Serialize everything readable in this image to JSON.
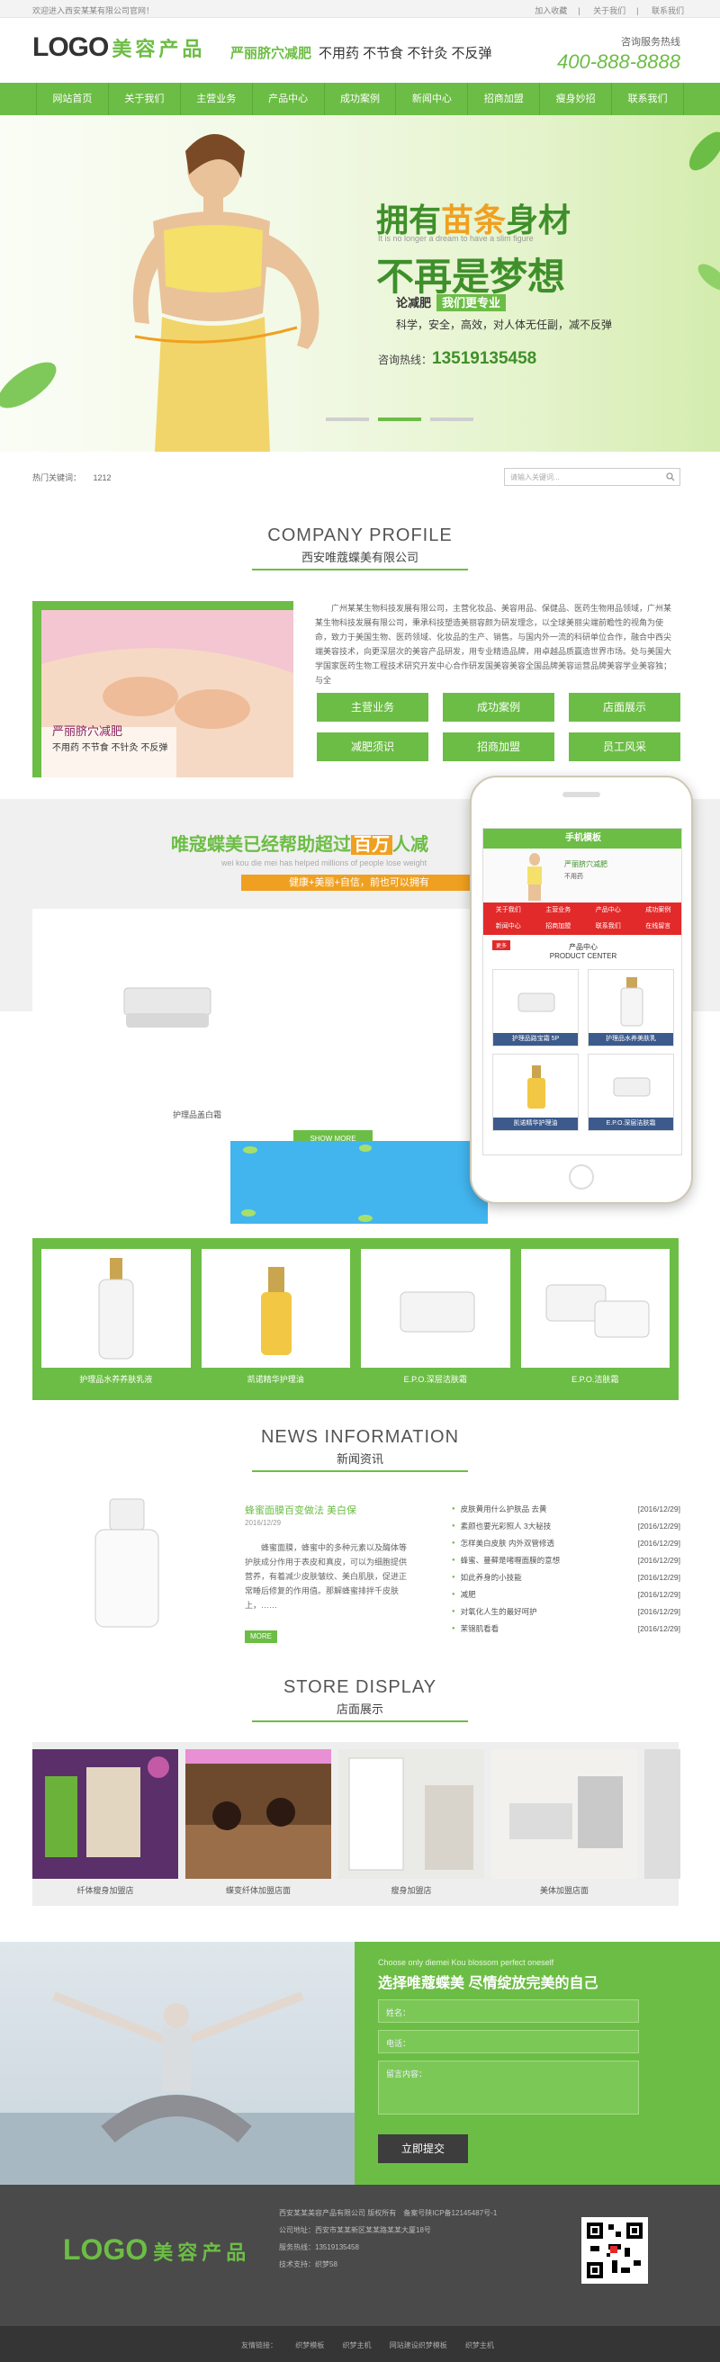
{
  "topbar": {
    "welcome": "欢迎进入西安某某有限公司官网！",
    "links": [
      "加入收藏",
      "关于我们",
      "联系我们"
    ]
  },
  "header": {
    "logo": "LOGO",
    "logo_cn": "美容产品",
    "slogan_green": "严丽脐穴减肥",
    "slogan_rest": "不用药 不节食 不针灸 不反弹",
    "hotline_label": "咨询服务热线",
    "hotline": "400-888-8888"
  },
  "nav": {
    "items": [
      "网站首页",
      "关于我们",
      "主营业务",
      "产品中心",
      "成功案例",
      "新闻中心",
      "招商加盟",
      "瘦身妙招",
      "联系我们"
    ]
  },
  "banner": {
    "title1_a": "拥有",
    "title1_b": "苗条",
    "title1_c": "身材",
    "subtitle": "It is no longer a dream to have a slim figure",
    "title2": "不再是梦想",
    "tag_a": "论减肥",
    "tag_b": "我们更专业",
    "desc": "科学，安全，高效，对人体无任副，减不反弹",
    "hot_label": "咨询热线：",
    "hot": "13519135458"
  },
  "searchbar": {
    "hot_label": "热门关键词：",
    "hot_value": "1212",
    "placeholder": "请输入关键词..."
  },
  "about": {
    "en": "COMPANY PROFILE",
    "cn": "西安唯蔻蝶美有限公司",
    "text": "广州某某生物科技发展有限公司，主营化妆品、美容用品、保健品、医药生物用品领域，广州某某生物科技发展有限公司，秉承科技塑造美丽容颜为研发理念，以全球美丽尖端前瞻性的视角为使命，致力于美国生物、医药领域、化妆品的生产、销售。与国内外一流的科研单位合作，融合中西尖端美容技术，向更深层次的美容产品研发，用专业精造品牌，用卓越品质赢造世界市场。处与美国大学国家医药生物工程技术研究开发中心合作研发国美容美容全国品牌美容运营品牌美容学业美容独；与全",
    "img_caption1": "严丽脐穴减肥",
    "img_caption2": "不用药 不节食 不针灸 不反弹",
    "buttons": [
      "主营业务",
      "成功案例",
      "店面展示",
      "减肥须识",
      "招商加盟",
      "员工风采"
    ]
  },
  "promo": {
    "title_a": "唯寇蝶美已经帮助超过",
    "title_b": "百万",
    "title_c": "人减",
    "sub": "wei kou die mei has helped millions of people lose weight",
    "bar": "健康+美丽+自信，前也可以拥有",
    "tile_caption": "护理品盖白霜",
    "tile_btn": "SHOW MORE"
  },
  "phone": {
    "header": "手机模板",
    "banner_line1": "严丽脐穴减肥",
    "banner_line2": "不用药",
    "nav": [
      "关于我们",
      "主营业务",
      "产品中心",
      "成功案例",
      "新闻中心",
      "招商加盟",
      "联系我们",
      "在线留言"
    ],
    "more": "更多",
    "prod_title": "产品中心",
    "prod_title_en": "PRODUCT CENTER",
    "items": [
      "护理品路宝霜 5P",
      "护理品水养美肤乳",
      "凯诺精华护理油",
      "E.P.O.深层洁肤霜"
    ]
  },
  "products": {
    "items": [
      "护理品水养养肤乳液",
      "凯诺精华护理油",
      "E.P.O.深层洁肤霜",
      "E.P.O.洁肤霜"
    ]
  },
  "news": {
    "en": "NEWS INFORMATION",
    "cn": "新闻资讯",
    "headline": "蜂蜜面膜百变做法 美白保",
    "date": "2016/12/29",
    "body": "蜂蜜面膜，蜂蜜中的多种元素以及酶体等护肤成分作用于表皮和真皮，可以为细胞提供营养，有着减少皮肤皱纹、美白肌肤，促进正常睡后修复的作用值。那解蜂蜜排拌千皮肤上，……",
    "more": "MORE",
    "list": [
      {
        "title": "皮肤黄用什么护肤品 去黄",
        "date": "[2016/12/29]"
      },
      {
        "title": "素颜也要光彩照人 3大秘技",
        "date": "[2016/12/29]"
      },
      {
        "title": "怎样美白皮肤 内外双管修透",
        "date": "[2016/12/29]"
      },
      {
        "title": "蜂蜜、蔓藓是啫喱面膜的意想",
        "date": "[2016/12/29]"
      },
      {
        "title": "如此养身的小技能",
        "date": "[2016/12/29]"
      },
      {
        "title": "减肥",
        "date": "[2016/12/29]"
      },
      {
        "title": "对氧化人生的最好呵护",
        "date": "[2016/12/29]"
      },
      {
        "title": "茉锦肌看看",
        "date": "[2016/12/29]"
      }
    ]
  },
  "store": {
    "en": "STORE DISPLAY",
    "cn": "店面展示",
    "items": [
      "纤体瘦身加盟店",
      "蝶变纤体加盟店面",
      "瘦身加盟店",
      "美体加盟店面"
    ]
  },
  "contact": {
    "en": "Choose only diemei Kou blossom perfect oneself",
    "cn": "选择唯蔻蝶美 尽情绽放完美的自己",
    "name": "姓名：",
    "phone": "电话：",
    "message": "留言内容：",
    "submit": "立即提交"
  },
  "footer": {
    "logo": "LOGO",
    "logo_cn": "美容产品",
    "info": [
      "西安某某美容产品有限公司 版权所有　备案号陕ICP备12145487号-1",
      "公司地址：西安市某某新区某某路某某大厦18号",
      "服务热线：13519135458",
      "技术支持：织梦58"
    ]
  },
  "bottombar": {
    "label": "友情链接：",
    "links": [
      "织梦模板",
      "织梦主机",
      "网站建设织梦模板",
      "织梦主机"
    ]
  },
  "colors": {
    "brand_green": "#6cbd45",
    "accent_orange": "#f0a020",
    "phone_nav_red": "#e22a2a",
    "footer_dark": "#4a4a4a"
  }
}
